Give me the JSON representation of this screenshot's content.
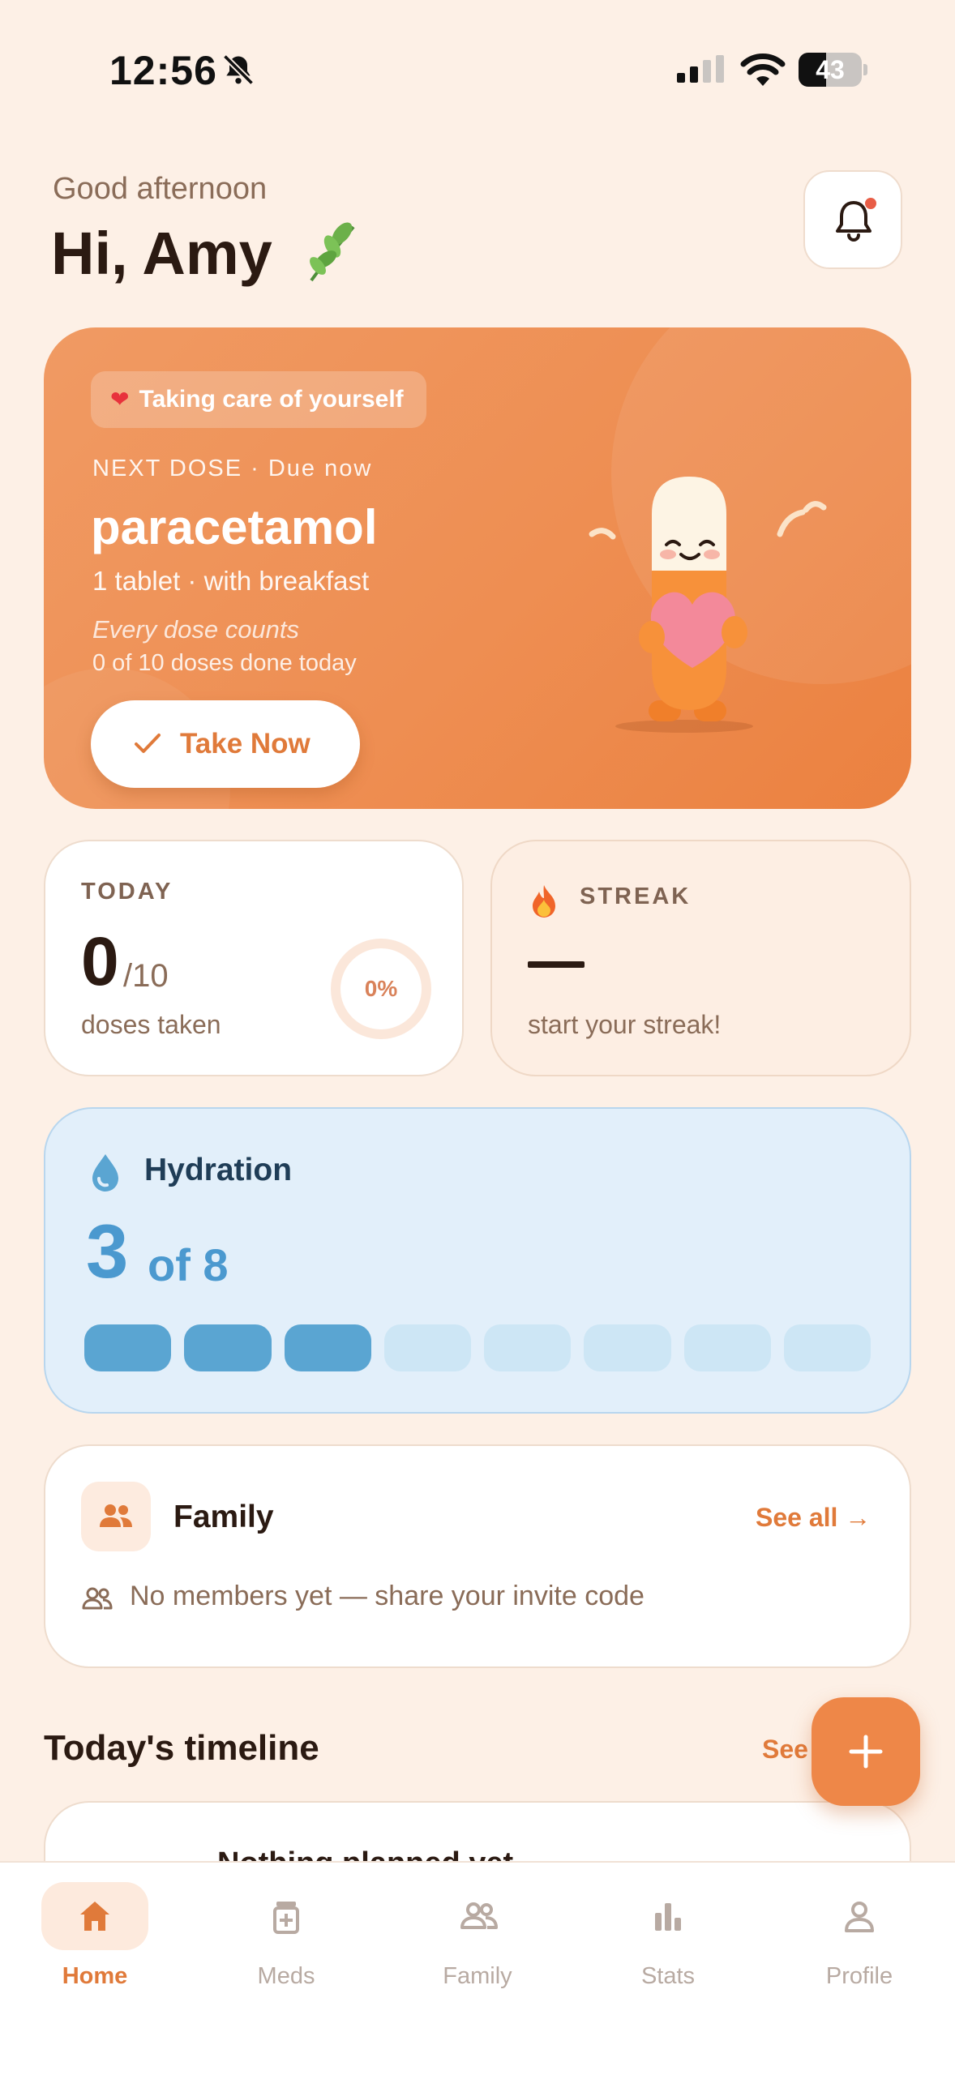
{
  "status_bar": {
    "time": "12:56",
    "battery": "43",
    "battery_level": 0.43,
    "icons": [
      "bell-off-icon",
      "signal-icon",
      "wifi-icon",
      "battery-icon"
    ]
  },
  "header": {
    "greeting": "Good afternoon",
    "hello": "Hi, Amy",
    "emoji_icon": "leaf-icon",
    "notification_icon": "bell-icon"
  },
  "hero": {
    "pill_label": "Taking care of yourself",
    "pill_icon": "heart-icon",
    "kicker": "NEXT DOSE · Due now",
    "med_name": "paracetamol",
    "detail": "1 tablet · with breakfast",
    "motto": "Every dose counts",
    "progress_text": "0 of 10 doses done today",
    "button_label": "Take Now",
    "button_icon": "check-icon",
    "mascot": "pill-mascot-illustration"
  },
  "today": {
    "label": "TODAY",
    "taken": "0",
    "total": "/10",
    "sub": "doses taken",
    "percent": "0%",
    "progress": 0
  },
  "streak": {
    "label": "STREAK",
    "icon": "fire-icon",
    "value": "—",
    "sub": "start your streak!"
  },
  "hydration": {
    "title": "Hydration",
    "icon": "water-drop-icon",
    "count": "3",
    "of_label": "of 8",
    "filled": 3,
    "total": 8
  },
  "family": {
    "title": "Family",
    "see_all": "See all →",
    "empty_text": "No members yet — share your invite code",
    "icon": "people-icon"
  },
  "timeline": {
    "title": "Today's timeline",
    "see_all": "See",
    "card_text": "Nothing planned yet"
  },
  "fab": {
    "icon": "plus-icon"
  },
  "nav": {
    "items": [
      {
        "label": "Home",
        "icon": "home-icon",
        "active": true
      },
      {
        "label": "Meds",
        "icon": "medicine-bottle-icon",
        "active": false
      },
      {
        "label": "Family",
        "icon": "people-icon",
        "active": false
      },
      {
        "label": "Stats",
        "icon": "bar-chart-icon",
        "active": false
      },
      {
        "label": "Profile",
        "icon": "person-icon",
        "active": false
      }
    ]
  },
  "colors": {
    "background": "#fdf0e6",
    "accent": "#e07a3a",
    "hero": "#ee8e52",
    "hydration": "#4b99cf"
  }
}
